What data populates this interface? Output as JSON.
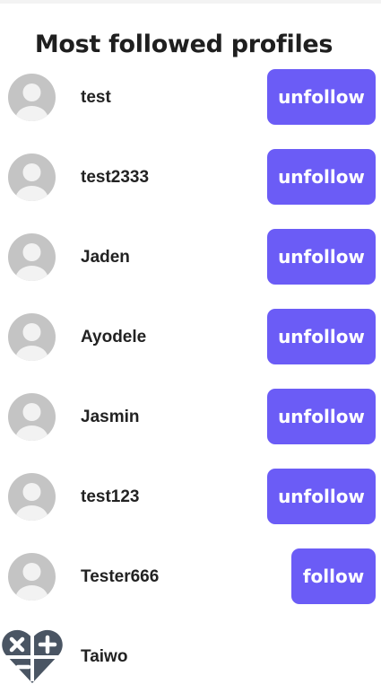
{
  "title": "Most followed profiles",
  "profiles": [
    {
      "name": "test",
      "action": "unfollow",
      "avatar_icon": "default-user-icon"
    },
    {
      "name": "test2333",
      "action": "unfollow",
      "avatar_icon": "default-user-icon"
    },
    {
      "name": "Jaden",
      "action": "unfollow",
      "avatar_icon": "default-user-icon"
    },
    {
      "name": "Ayodele",
      "action": "unfollow",
      "avatar_icon": "default-user-icon"
    },
    {
      "name": "Jasmin",
      "action": "unfollow",
      "avatar_icon": "default-user-icon"
    },
    {
      "name": "test123",
      "action": "unfollow",
      "avatar_icon": "default-user-icon"
    },
    {
      "name": "Tester666",
      "action": "follow",
      "avatar_icon": "default-user-icon"
    },
    {
      "name": "Taiwo",
      "action": "",
      "avatar_icon": "calculator-heart-icon"
    }
  ],
  "colors": {
    "button_bg": "#6b5cf6",
    "avatar_bg": "#c4c4c4",
    "avatar_fg": "#f2f2f2",
    "calc_icon": "#4a5563"
  }
}
